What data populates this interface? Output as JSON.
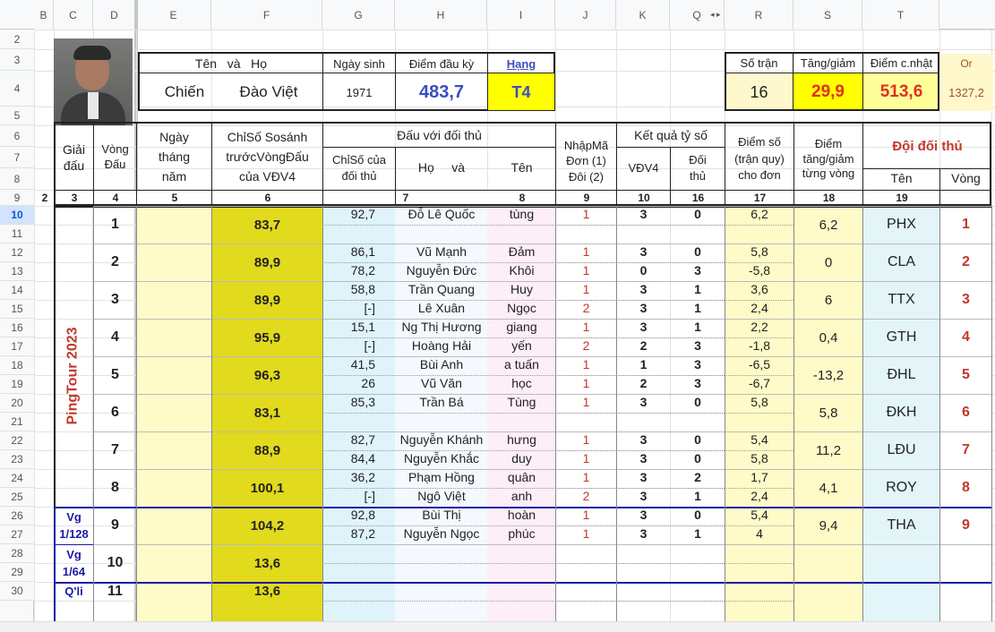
{
  "col_headers": [
    "B",
    "C",
    "D",
    "E",
    "F",
    "G",
    "H",
    "I",
    "J",
    "K",
    "Q",
    "R",
    "S",
    "T"
  ],
  "row_numbers": [
    "2",
    "3",
    "4",
    "5",
    "6",
    "7",
    "8",
    "9",
    "10",
    "11",
    "12",
    "13",
    "14",
    "15",
    "16",
    "17",
    "18",
    "19",
    "20",
    "21",
    "22",
    "23",
    "24",
    "25",
    "26",
    "27",
    "28",
    "29",
    "30"
  ],
  "selected_row": "10",
  "player": {
    "name_label": "Tên   và   Họ",
    "first_name": "Chiến",
    "last_name": "Đào Việt",
    "birth_label": "Ngày sinh",
    "birth_year": "1971",
    "start_score_label": "Điểm đầu kỳ",
    "start_score": "483,7",
    "rank_label": "Hạng",
    "rank": "T4"
  },
  "summary": {
    "matches_label": "Số trận",
    "matches": "16",
    "change_label": "Tăng/giảm",
    "change": "29,9",
    "updated_label": "Điểm c.nhật",
    "updated": "513,6",
    "or_label": "Or",
    "or_value": "1327,2"
  },
  "headers": {
    "tournament": "Giải đấu",
    "round": "Vòng Đấu",
    "date": "Ngày tháng năm",
    "compare": "ChỉSố Sosánh trướcVòngĐấu của VĐV4",
    "vs_opponent": "Đấu với đối thủ",
    "opp_index": "ChỉSố của đối thủ",
    "opp_last": "Họ     và",
    "opp_first": "Tên",
    "entry_code": "NhậpMã Đơn (1) Đôi (2)",
    "result": "Kết quả tỷ số",
    "result_self": "VĐV4",
    "result_opp": "Đối thủ",
    "points": "Điểm số (trận quy) cho đơn",
    "delta": "Điểm tăng/giảm từng vòng",
    "opp_team": "Đội đối thủ",
    "team_name": "Tên",
    "team_round": "Vòng"
  },
  "col_numbers": [
    "2",
    "3",
    "4",
    "5",
    "6",
    "7",
    "8",
    "9",
    "10",
    "16",
    "17",
    "18",
    "19"
  ],
  "tournament_name": "PingTour 2023",
  "rounds": [
    {
      "round": "1",
      "compare": "83,7",
      "delta": "6,2",
      "team": "PHX",
      "vong": "1",
      "matches": [
        {
          "idx": "92,7",
          "last": "Đỗ Lê Quốc",
          "first": "tùng",
          "code": "1",
          "a": "3",
          "b": "0",
          "pts": "6,2"
        }
      ]
    },
    {
      "round": "2",
      "compare": "89,9",
      "delta": "0",
      "team": "CLA",
      "vong": "2",
      "matches": [
        {
          "idx": "86,1",
          "last": "Vũ Mạnh",
          "first": "Đảm",
          "code": "1",
          "a": "3",
          "b": "0",
          "pts": "5,8"
        },
        {
          "idx": "78,2",
          "last": "Nguyễn Đức",
          "first": "Khôi",
          "code": "1",
          "a": "0",
          "b": "3",
          "pts": "-5,8"
        }
      ]
    },
    {
      "round": "3",
      "compare": "89,9",
      "delta": "6",
      "team": "TTX",
      "vong": "3",
      "matches": [
        {
          "idx": "58,8",
          "last": "Trần Quang",
          "first": "Huy",
          "code": "1",
          "a": "3",
          "b": "1",
          "pts": "3,6"
        },
        {
          "idx": "[-]",
          "last": "Lê Xuân",
          "first": "Ngọc",
          "code": "2",
          "a": "3",
          "b": "1",
          "pts": "2,4"
        }
      ]
    },
    {
      "round": "4",
      "compare": "95,9",
      "delta": "0,4",
      "team": "GTH",
      "vong": "4",
      "matches": [
        {
          "idx": "15,1",
          "last": "Ng Thị Hương",
          "first": "giang",
          "code": "1",
          "a": "3",
          "b": "1",
          "pts": "2,2"
        },
        {
          "idx": "[-]",
          "last": "Hoàng Hải",
          "first": "yến",
          "code": "2",
          "a": "2",
          "b": "3",
          "pts": "-1,8"
        }
      ]
    },
    {
      "round": "5",
      "compare": "96,3",
      "delta": "-13,2",
      "team": "ĐHL",
      "vong": "5",
      "matches": [
        {
          "idx": "41,5",
          "last": "Bùi Anh",
          "first": "a tuấn",
          "code": "1",
          "a": "1",
          "b": "3",
          "pts": "-6,5"
        },
        {
          "idx": "26",
          "last": "Vũ Văn",
          "first": "học",
          "code": "1",
          "a": "2",
          "b": "3",
          "pts": "-6,7"
        }
      ]
    },
    {
      "round": "6",
      "compare": "83,1",
      "delta": "5,8",
      "team": "ĐKH",
      "vong": "6",
      "matches": [
        {
          "idx": "85,3",
          "last": "Trần Bá",
          "first": "Tùng",
          "code": "1",
          "a": "3",
          "b": "0",
          "pts": "5,8"
        }
      ]
    },
    {
      "round": "7",
      "compare": "88,9",
      "delta": "11,2",
      "team": "LĐU",
      "vong": "7",
      "matches": [
        {
          "idx": "82,7",
          "last": "Nguyễn Khánh",
          "first": "hưng",
          "code": "1",
          "a": "3",
          "b": "0",
          "pts": "5,4"
        },
        {
          "idx": "84,4",
          "last": "Nguyễn Khắc",
          "first": "duy",
          "code": "1",
          "a": "3",
          "b": "0",
          "pts": "5,8"
        }
      ]
    },
    {
      "round": "8",
      "compare": "100,1",
      "delta": "4,1",
      "team": "ROY",
      "vong": "8",
      "matches": [
        {
          "idx": "36,2",
          "last": "Phạm Hồng",
          "first": "quân",
          "code": "1",
          "a": "3",
          "b": "2",
          "pts": "1,7"
        },
        {
          "idx": "[-]",
          "last": "Ngô Việt",
          "first": "anh",
          "code": "2",
          "a": "3",
          "b": "1",
          "pts": "2,4"
        }
      ]
    },
    {
      "round": "9",
      "stage": "Vg 1/128",
      "compare": "104,2",
      "delta": "9,4",
      "team": "THA",
      "vong": "9",
      "matches": [
        {
          "idx": "92,8",
          "last": "Bùi Thị",
          "first": "hoàn",
          "code": "1",
          "a": "3",
          "b": "0",
          "pts": "5,4"
        },
        {
          "idx": "87,2",
          "last": "Nguyễn Ngọc",
          "first": "phúc",
          "code": "1",
          "a": "3",
          "b": "1",
          "pts": "4"
        }
      ]
    },
    {
      "round": "10",
      "stage": "Vg 1/64",
      "compare": "13,6"
    },
    {
      "round": "11",
      "stage": "Q'li",
      "compare": "13,6"
    }
  ]
}
